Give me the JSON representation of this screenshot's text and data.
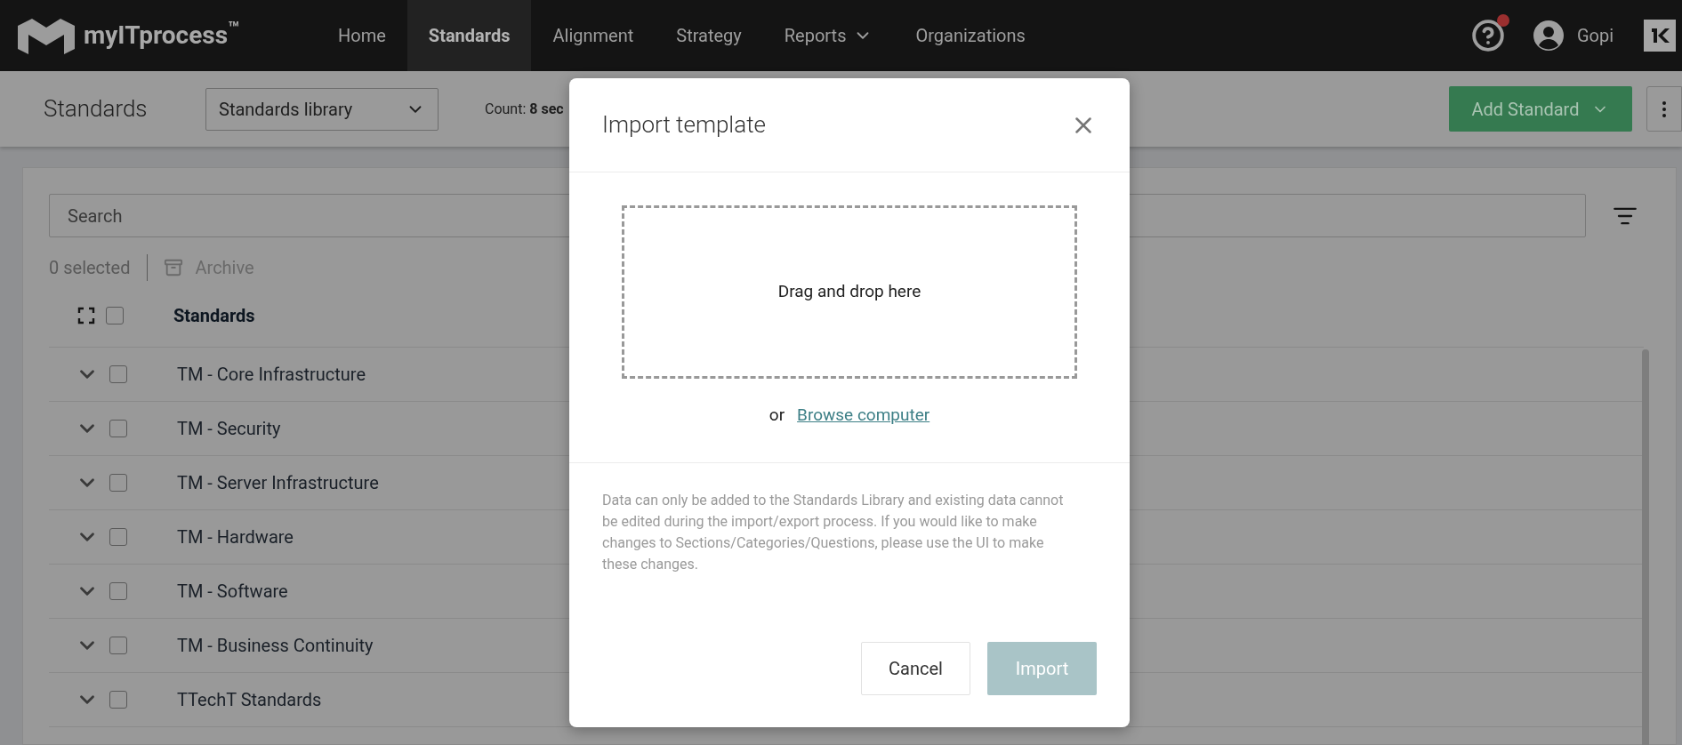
{
  "nav": {
    "logo": "myITprocess$^{™}$",
    "items": [
      {
        "label": "Home",
        "selected": false,
        "dropdown": false
      },
      {
        "label": "Standards",
        "selected": true,
        "dropdown": false
      },
      {
        "label": "Alignment",
        "selected": false,
        "dropdown": false
      },
      {
        "label": "Strategy",
        "selected": false,
        "dropdown": false
      },
      {
        "label": "Reports",
        "selected": false,
        "dropdown": true
      },
      {
        "label": "Organizations",
        "selected": false,
        "dropdown": false
      }
    ],
    "help_alert": true,
    "user": "Gopi"
  },
  "header": {
    "title": "Standards",
    "library_select": "Standards library",
    "count": "Count: **8 sec**",
    "add_button": "Add Standard"
  },
  "search": {
    "placeholder": "Search"
  },
  "selection": {
    "count": "0 selected",
    "archive": "Archive"
  },
  "table": {
    "column": "Standards",
    "all_checked": false,
    "rows": [
      {
        "name": "TM - Core Infrastructure",
        "checked": false,
        "expanded": false
      },
      {
        "name": "TM - Security",
        "checked": false,
        "expanded": false
      },
      {
        "name": "TM - Server Infrastructure",
        "checked": false,
        "expanded": false
      },
      {
        "name": "TM - Hardware",
        "checked": false,
        "expanded": false
      },
      {
        "name": "TM - Software",
        "checked": false,
        "expanded": false
      },
      {
        "name": "TM - Business Continuity",
        "checked": false,
        "expanded": false
      },
      {
        "name": "TTechT Standards",
        "checked": false,
        "expanded": false
      }
    ]
  },
  "dialog": {
    "title": "Import template",
    "dropzone": "Drag and drop here",
    "or": "or",
    "browse_link": "Browse computer",
    "note": "Data can only be added to the Standards Library and existing data cannot be edited during the import/export process. If you would like to make changes to Sections/Categories/Questions, please use the UI to make these changes.",
    "cancel": "Cancel",
    "import": {
      "label": "Import",
      "disabled": true
    }
  }
}
